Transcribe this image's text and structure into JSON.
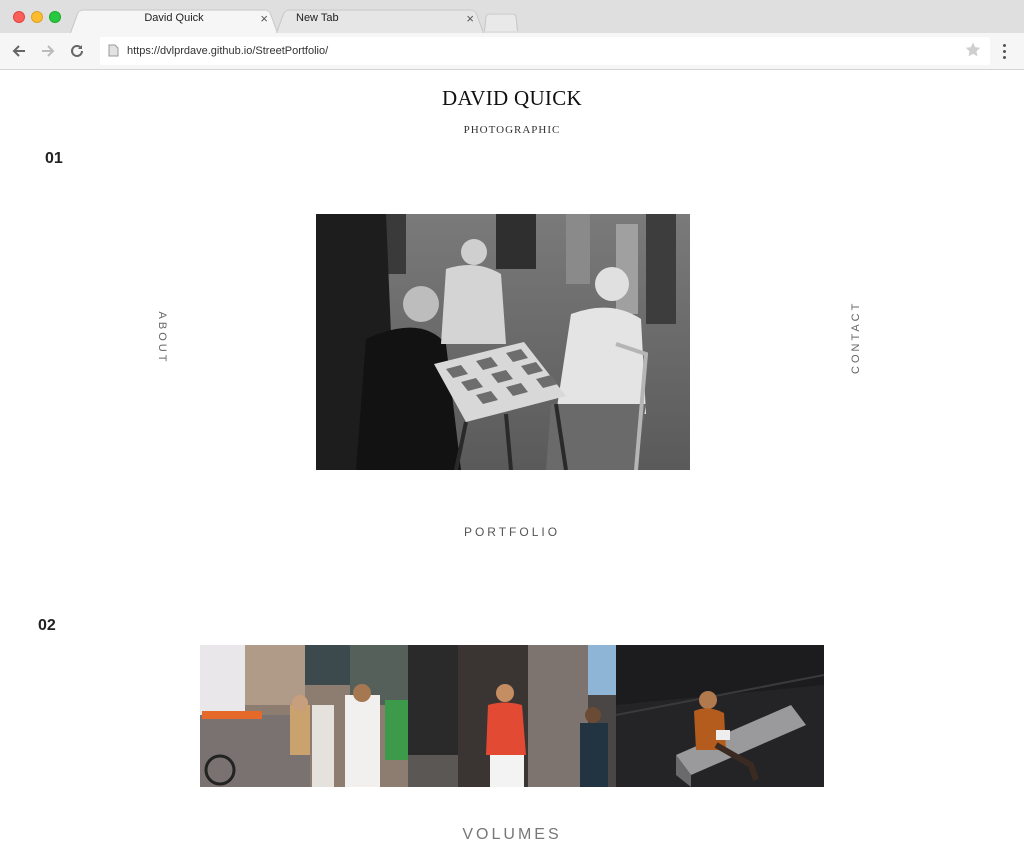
{
  "browser": {
    "tabs": [
      {
        "title": "David Quick",
        "active": true
      },
      {
        "title": "New Tab",
        "active": false
      }
    ],
    "url": "https://dvlprdave.github.io/StreetPortfolio/"
  },
  "site": {
    "title": "DAVID QUICK",
    "subtitle": "PHOTOGRAPHIC",
    "nav": {
      "about": "ABOUT",
      "contact": "CONTACT"
    },
    "sections": [
      {
        "number": "01",
        "link": "PORTFOLIO"
      },
      {
        "number": "02",
        "link": "VOLUMES"
      }
    ]
  },
  "icons": [
    "back-icon",
    "forward-icon",
    "reload-icon",
    "page-icon",
    "star-icon",
    "menu-icon",
    "close-icon"
  ]
}
